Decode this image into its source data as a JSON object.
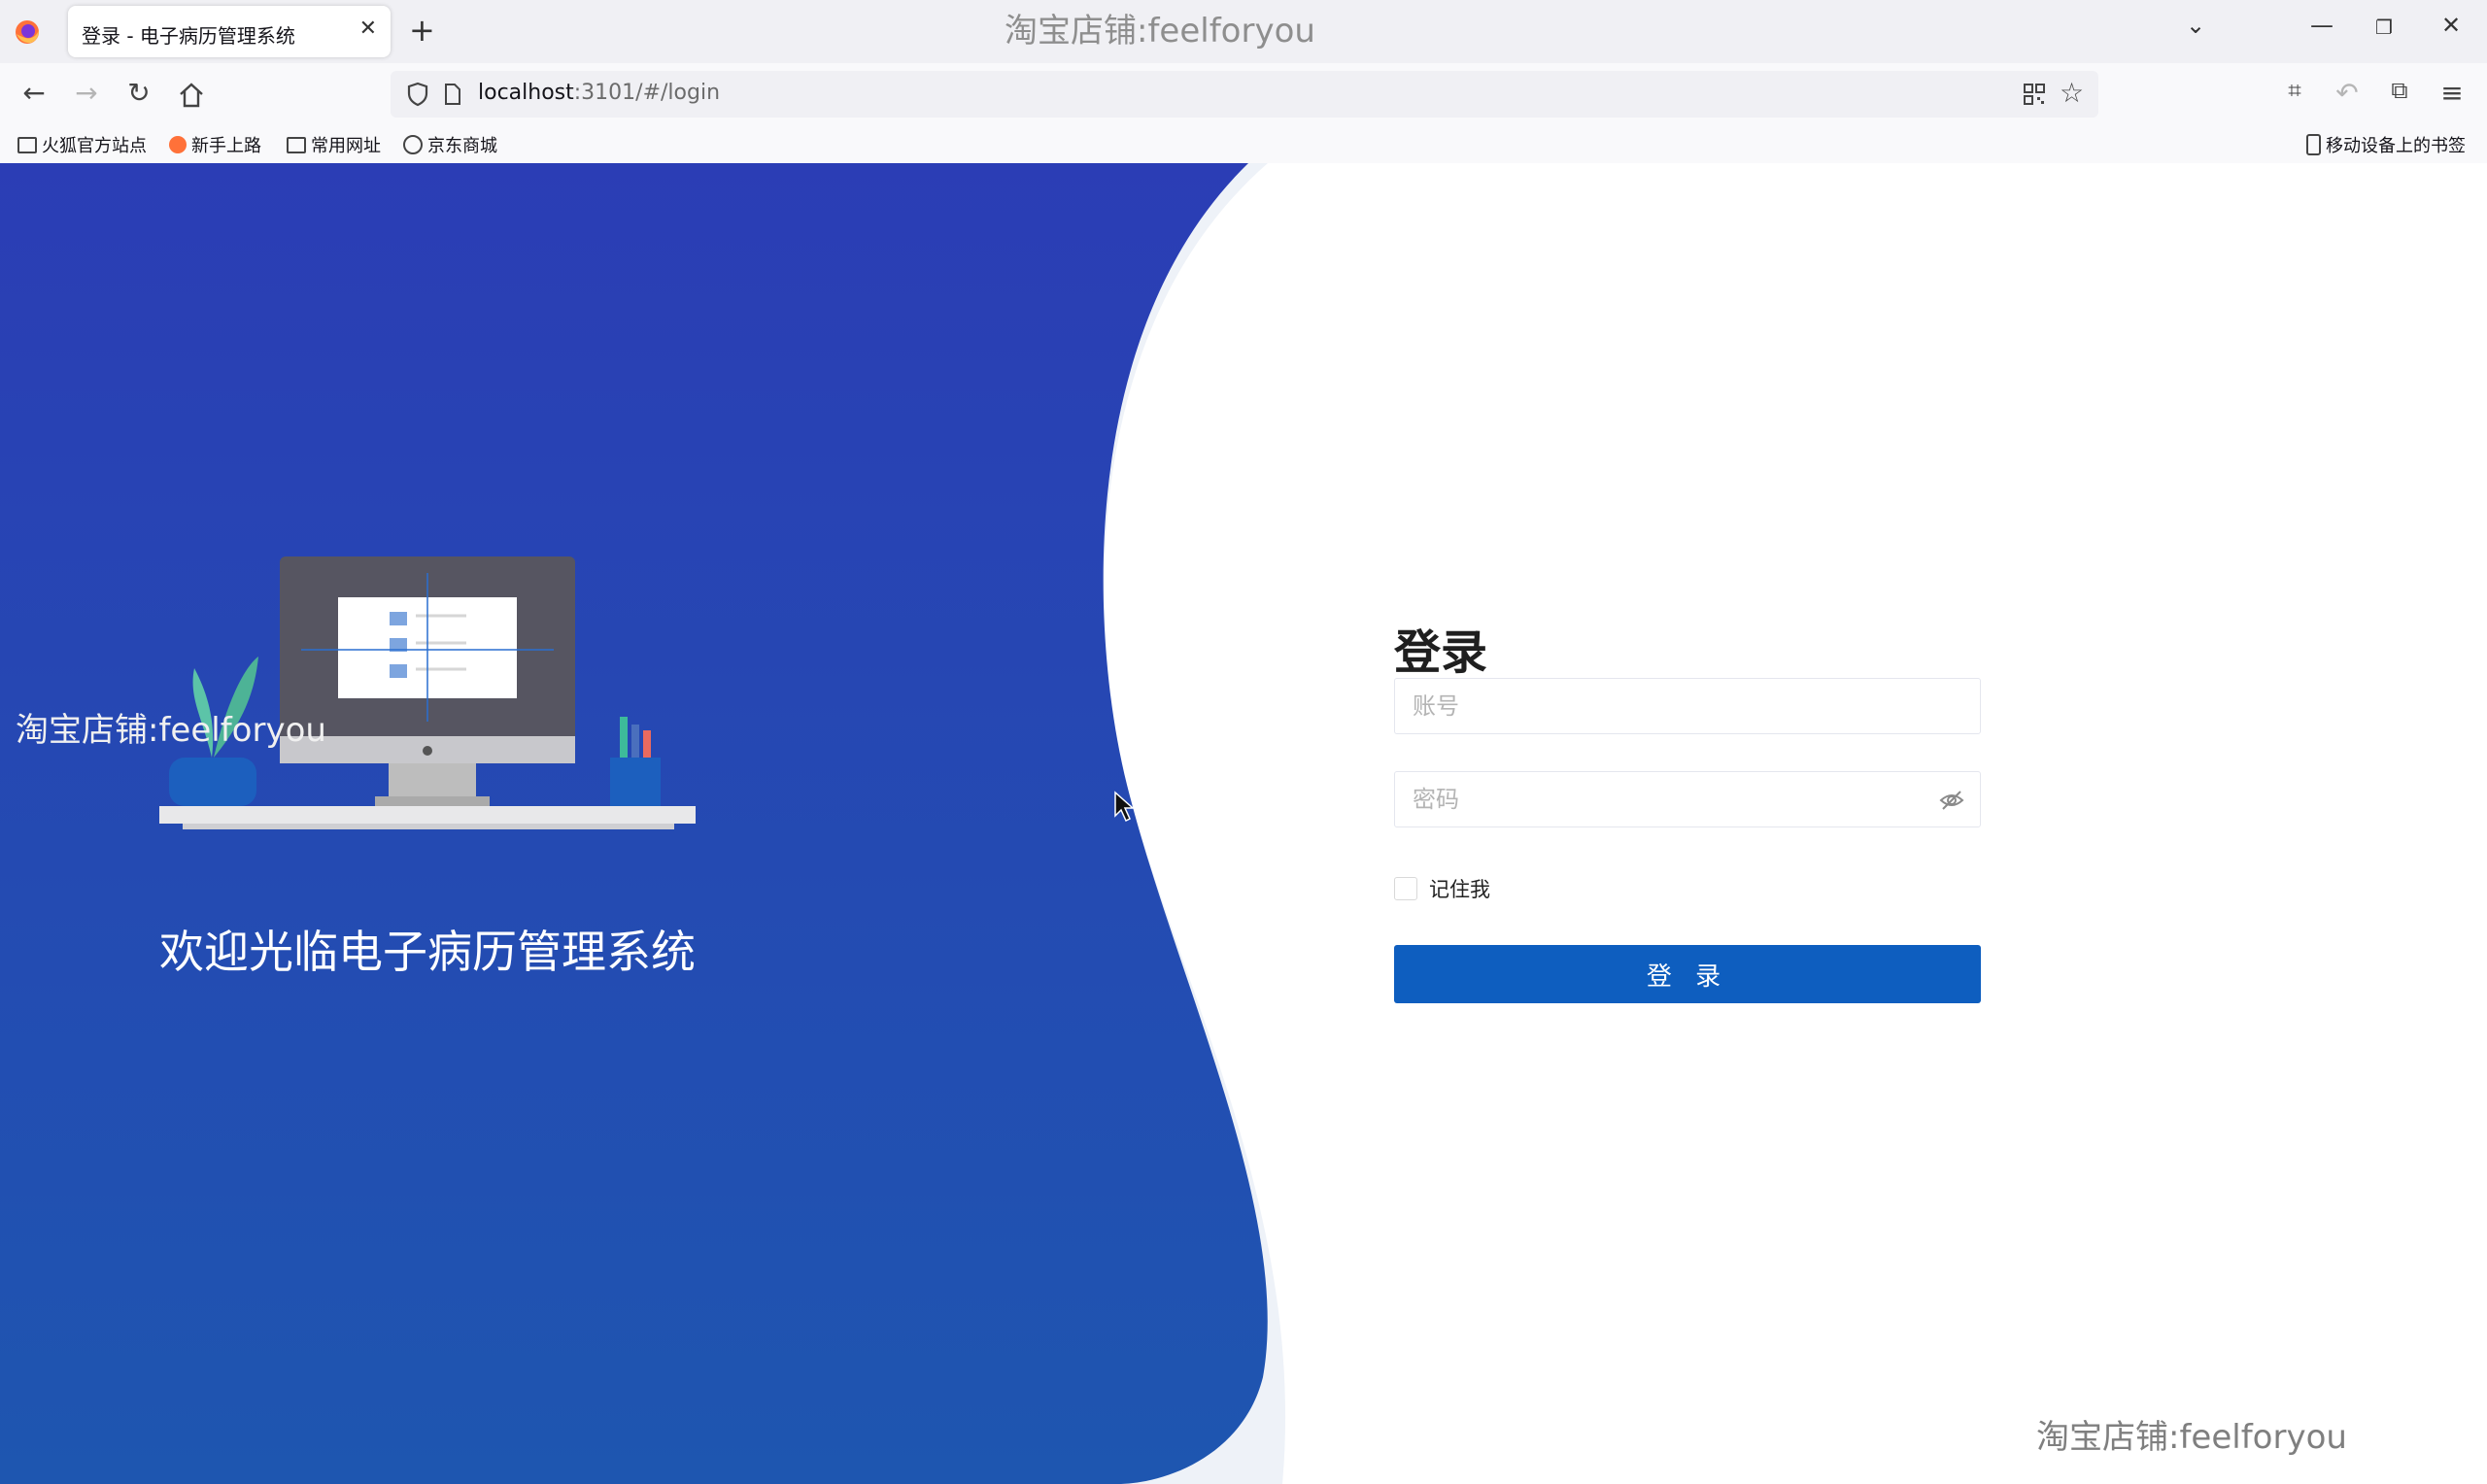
{
  "browser": {
    "tab_title": "登录 - 电子病历管理系统",
    "new_tab_label": "+",
    "url_host": "localhost",
    "url_path": ":3101/#/login",
    "bookmarks": [
      "火狐官方站点",
      "新手上路",
      "常用网址",
      "京东商城"
    ],
    "mobile_bookmarks": "移动设备上的书签",
    "icons": {
      "back": "back-arrow-icon",
      "forward": "forward-arrow-icon",
      "reload": "reload-icon",
      "home": "home-icon",
      "shield": "shield-icon",
      "page": "page-icon",
      "qr": "qr-code-icon",
      "star": "bookmark-star-icon",
      "menu": "hamburger-menu-icon"
    }
  },
  "watermark": "淘宝店铺:feelforyou",
  "page": {
    "welcome_text": "欢迎光临电子病历管理系统",
    "login_title": "登录",
    "account_placeholder": "账号",
    "password_placeholder": "密码",
    "remember_label": "记住我",
    "login_button": "登 录"
  },
  "colors": {
    "primary_blue": "#0e5ebf",
    "panel_blue_top": "#2b3db5",
    "panel_blue_bottom": "#1e56b0"
  }
}
